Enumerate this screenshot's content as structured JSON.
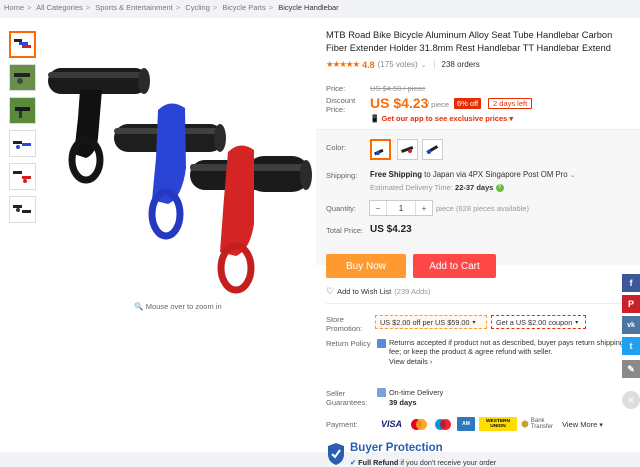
{
  "breadcrumb": [
    "Home",
    "All Categories",
    "Sports & Entertainment",
    "Cycling",
    "Bicycle Parts",
    "Bicycle Handlebar"
  ],
  "product": {
    "title": "MTB Road Bike Bicycle Aluminum Alloy Seat Tube Handlebar Carbon Fiber Extender Holder 31.8mm Rest Handlebar TT Handlebar Extend",
    "stars": "★★★★★",
    "rating": "4.8",
    "votes": "(175 votes)",
    "orders": "238 orders"
  },
  "price": {
    "label": "Price:",
    "original": "US $4.50 / piece",
    "discount_label": "Discount Price:",
    "current": "US $4.23",
    "unit": "/ piece",
    "off_badge": "6% off",
    "days_left": "2 days left",
    "app_promo": "Get our app to see exclusive prices"
  },
  "color": {
    "label": "Color:",
    "selected_index": 0
  },
  "shipping": {
    "label": "Shipping:",
    "free_text": "Free Shipping",
    "rest": "to Japan via 4PX Singapore Post OM Pro",
    "estimated_label": "Estimated Delivery Time:",
    "estimated_value": "22-37 days"
  },
  "quantity": {
    "label": "Quantity:",
    "minus": "−",
    "value": "1",
    "plus": "+",
    "available": "piece (628 pieces available)"
  },
  "total": {
    "label": "Total Price:",
    "value": "US $4.23"
  },
  "actions": {
    "buy_now": "Buy Now",
    "add_to_cart": "Add to Cart",
    "wishlist": "Add to Wish List",
    "wishlist_count": "(239 Adds)"
  },
  "promotion": {
    "label": "Store Promotion:",
    "coupon1": "US $2.00 off per US $59.00",
    "coupon2": "Get a US $2.00 coupon"
  },
  "return_policy": {
    "label": "Return Policy",
    "text": "Returns accepted if product not as described, buyer pays return shipping fee; or keep the product & agree refund with seller.",
    "link": "View details"
  },
  "guarantee": {
    "label": "Seller Guarantees:",
    "text": "On-time Delivery",
    "days": "39 days"
  },
  "payment": {
    "label": "Payment:",
    "methods": [
      "VISA",
      "MC",
      "Maestro",
      "AmEx",
      "WESTERN UNION",
      "Bank Transfer"
    ],
    "view_more": "View More"
  },
  "protection": {
    "title": "Buyer Protection",
    "refund_strong": "Full Refund",
    "refund_rest": "if you don't receive your order"
  },
  "zoom_hint": "Mouse over to zoom in",
  "social": [
    "f",
    "P",
    "vk",
    "t",
    "✎"
  ],
  "colors": {
    "orange": "#ff6a00",
    "buy_now": "#ff9a33",
    "add_to_cart": "#ff4747",
    "facebook": "#3b5998",
    "pinterest": "#cb2027",
    "vk": "#4c75a3",
    "twitter": "#1da1f2"
  }
}
